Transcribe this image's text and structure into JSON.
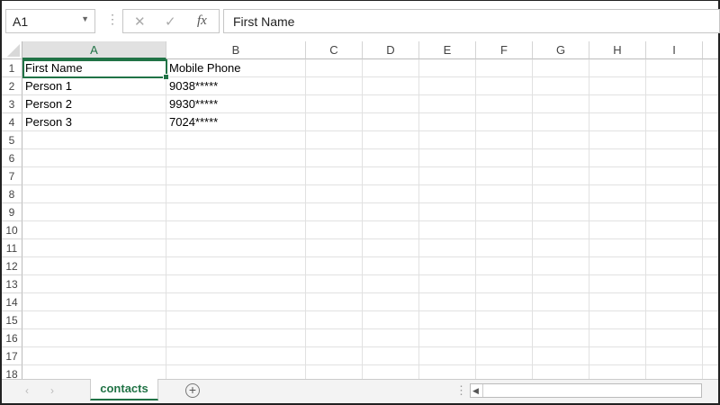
{
  "name_box": "A1",
  "formula_bar": {
    "cancel": "✕",
    "enter": "✓",
    "fx": "fx",
    "value": "First Name"
  },
  "columns": [
    "A",
    "B",
    "C",
    "D",
    "E",
    "F",
    "G",
    "H",
    "I"
  ],
  "rows": [
    "1",
    "2",
    "3",
    "4",
    "5",
    "6",
    "7",
    "8",
    "9",
    "10",
    "11",
    "12",
    "13",
    "14",
    "15",
    "16",
    "17",
    "18"
  ],
  "cells": [
    [
      "First Name",
      "Mobile Phone"
    ],
    [
      "Person 1",
      "9038*****"
    ],
    [
      "Person 2",
      "9930*****"
    ],
    [
      "Person 3",
      "7024*****"
    ]
  ],
  "sheet_tab": "contacts",
  "add_sheet": "+",
  "accent": "#217346"
}
